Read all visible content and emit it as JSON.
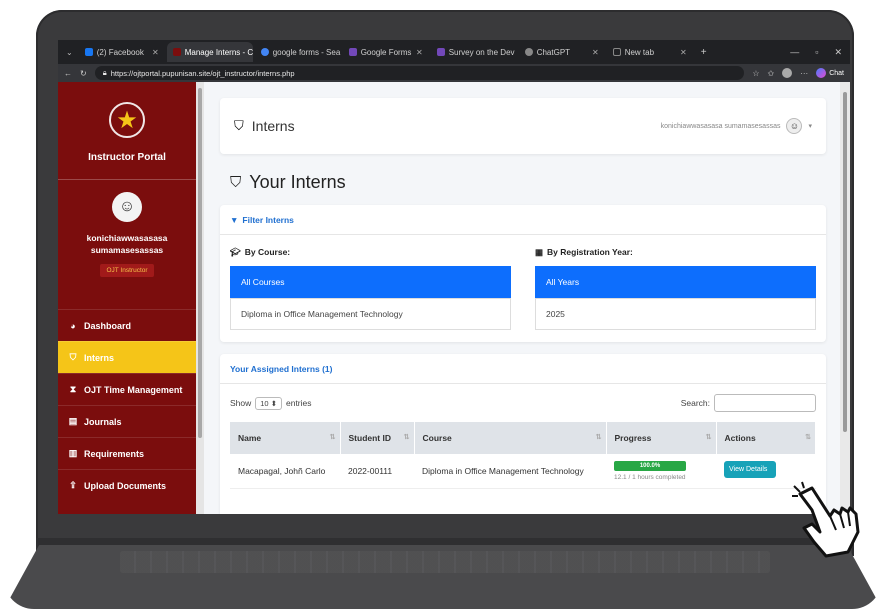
{
  "browser": {
    "tabs": [
      {
        "label": "(2) Facebook",
        "color": "#1877f2"
      },
      {
        "label": "Manage Interns - C",
        "color": "#7b0d0d"
      },
      {
        "label": "google forms - Sea",
        "color": "#4285f4"
      },
      {
        "label": "Google Forms",
        "color": "#7248b9"
      },
      {
        "label": "Survey on the Dev",
        "color": "#7248b9"
      },
      {
        "label": "ChatGPT",
        "color": "#888888"
      },
      {
        "label": "New tab",
        "color": "#888888"
      }
    ],
    "url": "https://ojtportal.pupunisan.site/ojt_instructor/interns.php",
    "chat_label": "Chat"
  },
  "sidebar": {
    "portal_title": "Instructor Portal",
    "user_name_1": "konichiawwasasasa",
    "user_name_2": "sumamasesassas",
    "role": "OJT Instructor",
    "items": [
      {
        "label": "Dashboard",
        "icon": "palette-icon"
      },
      {
        "label": "Interns",
        "icon": "user-tie-icon"
      },
      {
        "label": "OJT Time Management",
        "icon": "hourglass-icon"
      },
      {
        "label": "Journals",
        "icon": "book-icon"
      },
      {
        "label": "Requirements",
        "icon": "file-icon"
      },
      {
        "label": "Upload Documents",
        "icon": "upload-icon"
      }
    ]
  },
  "topbar": {
    "title": "Interns",
    "user": "konichiawwasasasa sumamasesassas"
  },
  "page": {
    "heading": "Your Interns"
  },
  "filter": {
    "title": "Filter Interns",
    "course_label": "By Course:",
    "courses": [
      "All Courses",
      "Diploma in Office Management Technology"
    ],
    "year_label": "By Registration Year:",
    "years": [
      "All Years",
      "2025"
    ]
  },
  "assigned": {
    "title": "Your Assigned Interns (1)",
    "show": "Show",
    "entries_value": "10",
    "entries": "entries",
    "search_label": "Search:",
    "columns": [
      "Name",
      "Student ID",
      "Course",
      "Progress",
      "Actions"
    ],
    "rows": [
      {
        "name": "Macapagal, Johñ Carlo",
        "student_id": "2022-00111",
        "course": "Diploma in Office Management Technology",
        "progress_pct": "100.0%",
        "progress_value": 1.0,
        "progress_sub": "12.1 / 1 hours completed",
        "action": "View Details"
      }
    ]
  },
  "colors": {
    "sidebar": "#7b0d0d",
    "active_nav": "#f5c518",
    "primary": "#0d6efd",
    "success": "#28a745",
    "info": "#17a2b8"
  }
}
